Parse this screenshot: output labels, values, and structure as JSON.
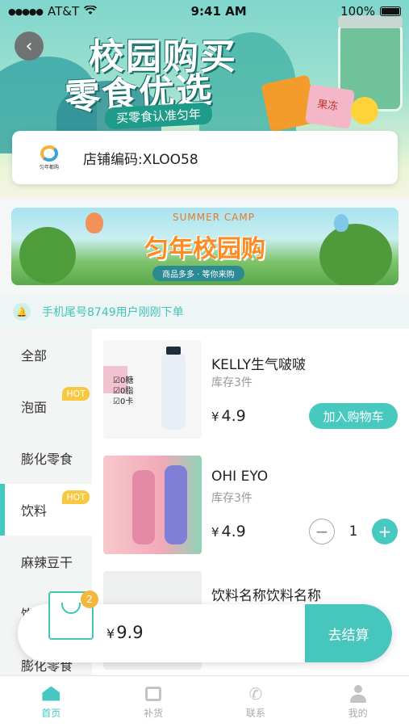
{
  "status_bar": {
    "carrier": "AT&T",
    "time": "9:41 AM",
    "battery": "100%"
  },
  "hero": {
    "title_line1": "校园购买",
    "title_line2": "零食优选",
    "tagline": "买零食认准匀年",
    "snack_label": "果冻"
  },
  "store": {
    "logo_name": "匀年都购",
    "code_text": "店铺编码:XLOO58"
  },
  "banner": {
    "camp_text": "SUMMER CAMP",
    "title": "匀年校园购",
    "subtitle": "商品多多 · 等你来购"
  },
  "notice": {
    "text": "手机尾号8749用户刚刚下单"
  },
  "categories": [
    {
      "label": "全部",
      "hot": ""
    },
    {
      "label": "泡面",
      "hot": "HOT"
    },
    {
      "label": "膨化零食",
      "hot": ""
    },
    {
      "label": "饮料",
      "hot": "HOT"
    },
    {
      "label": "麻辣豆干",
      "hot": ""
    },
    {
      "label": "饮料",
      "hot": ""
    },
    {
      "label": "膨化零食",
      "hot": ""
    }
  ],
  "products": [
    {
      "name": "KELLY生气啵啵",
      "stock": "库存3件",
      "currency": "¥",
      "price": "4.9",
      "action": "加入购物车",
      "image_text": "☑0糖\n☑0脂\n☑0卡"
    },
    {
      "name": "OHI EYO",
      "stock": "库存3件",
      "currency": "¥",
      "price": "4.9",
      "quantity": "1"
    },
    {
      "name": "饮料名称饮料名称",
      "stock": "",
      "currency": "",
      "price": ""
    }
  ],
  "cart": {
    "badge": "2",
    "currency": "¥",
    "total": "9.9",
    "checkout_label": "去结算"
  },
  "tabbar": [
    {
      "label": "首页",
      "icon": "home-icon"
    },
    {
      "label": "补货",
      "icon": "replenish-icon"
    },
    {
      "label": "联系",
      "icon": "phone-icon"
    },
    {
      "label": "我的",
      "icon": "user-icon"
    }
  ],
  "colors": {
    "accent": "#44c8c0",
    "hot_badge": "#f7c93f",
    "cart_badge": "#f3b73e"
  }
}
